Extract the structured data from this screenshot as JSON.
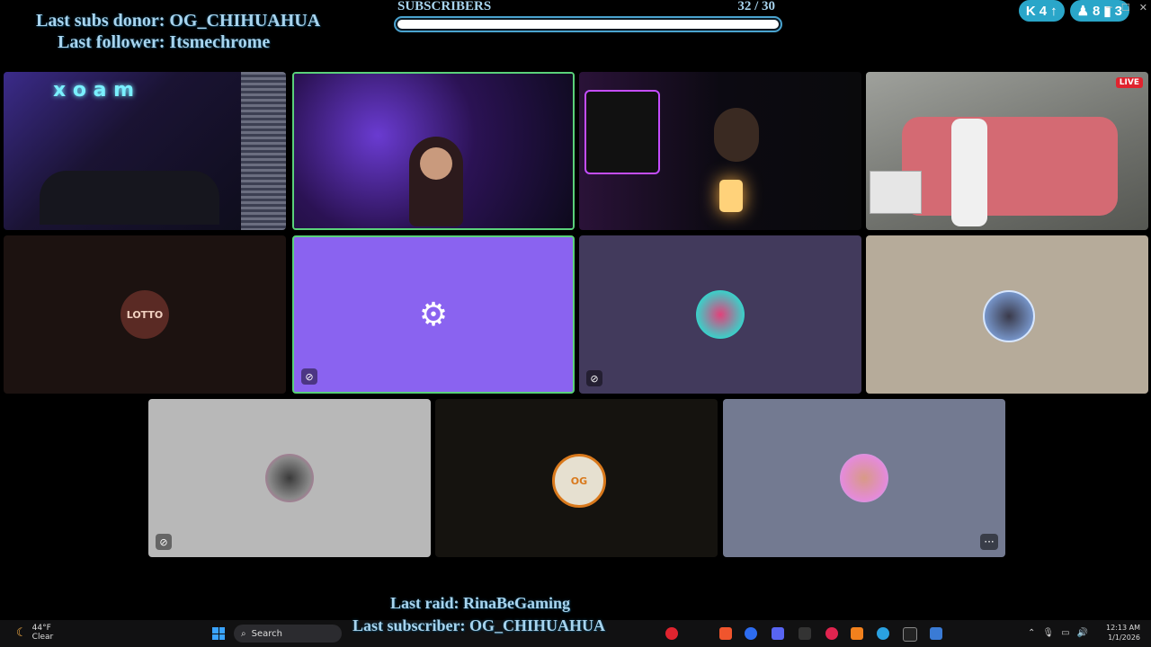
{
  "overlay": {
    "donor": "Last subs donor: OG_CHIHUAHUA",
    "follower": "Last follower: Itsmechrome",
    "raid": "Last raid: RinaBeGaming",
    "subscriber": "Last subscriber: OG_CHIHUAHUA"
  },
  "sub_goal": {
    "title": "SUBSCRIBERS",
    "count": "32  / 30",
    "progress": 1.0
  },
  "counters": {
    "kick": "4",
    "viewers": "8",
    "chart": "3"
  },
  "live_label": "LIVE",
  "tiles": [
    {
      "name": "camera-bedroom",
      "bg": "#1b1633"
    },
    {
      "name": "camera-purple-girl",
      "bg": "#2a1350"
    },
    {
      "name": "camera-neon-pc",
      "bg": "#120c16"
    },
    {
      "name": "camera-game-stream",
      "bg": "#7d7f7a"
    },
    {
      "name": "avatar-lotto",
      "bg": "#1c1210",
      "avatar_text": "LOTTO"
    },
    {
      "name": "avatar-gears",
      "bg": "#8a63f0"
    },
    {
      "name": "avatar-lips",
      "bg": "#423a5c"
    },
    {
      "name": "avatar-suit",
      "bg": "#b6ab9a"
    },
    {
      "name": "avatar-pink-hat",
      "bg": "#b8b8b8"
    },
    {
      "name": "avatar-og",
      "bg": "#15130f",
      "avatar_text": "OG"
    },
    {
      "name": "avatar-girl",
      "bg": "#737a91"
    }
  ],
  "taskbar": {
    "weather_temp": "44°F",
    "weather_cond": "Clear",
    "search": "Search",
    "time": "12:13 AM",
    "date": "1/1/2026"
  }
}
